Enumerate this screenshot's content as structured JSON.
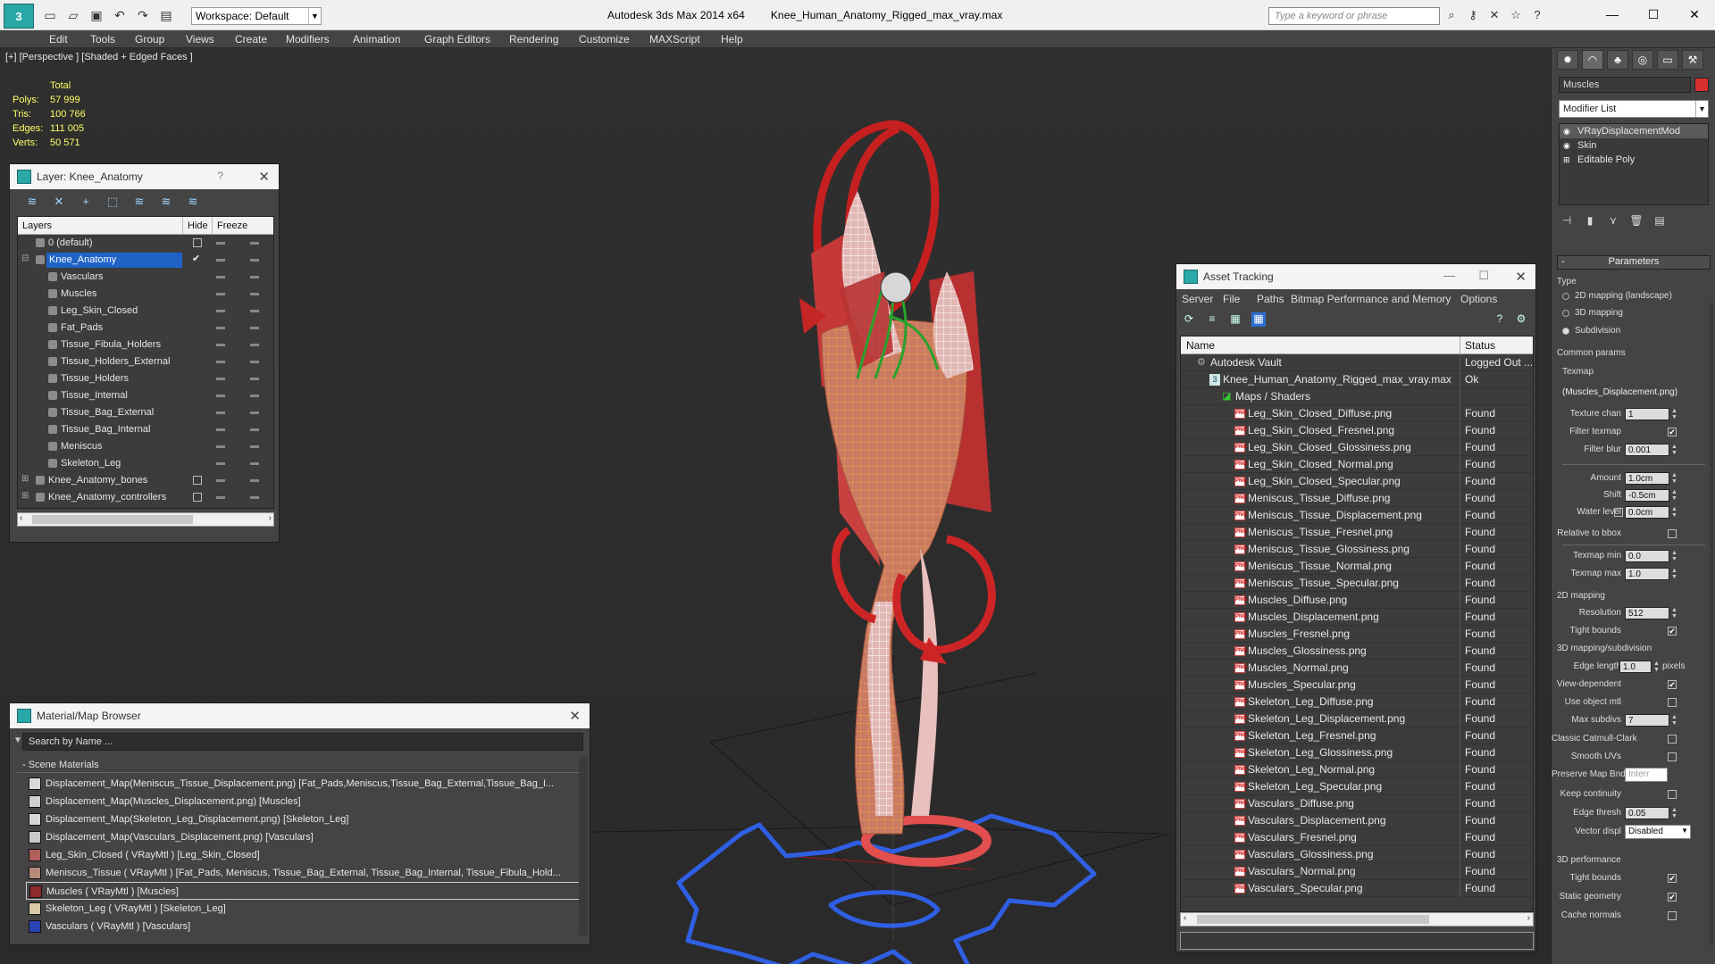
{
  "app": {
    "title": "Autodesk 3ds Max  2014 x64",
    "file": "Knee_Human_Anatomy_Rigged_max_vray.max",
    "workspace": "Workspace: Default",
    "search_placeholder": "Type a keyword or phrase"
  },
  "menu": [
    "Edit",
    "Tools",
    "Group",
    "Views",
    "Create",
    "Modifiers",
    "Animation",
    "Graph Editors",
    "Rendering",
    "Customize",
    "MAXScript",
    "Help"
  ],
  "viewport": {
    "label": "[+] [Perspective ] [Shaded + Edged Faces ]",
    "stats": {
      "header": "Total",
      "rows": [
        {
          "k": "Polys:",
          "v": "57 999"
        },
        {
          "k": "Tris:",
          "v": "100 766"
        },
        {
          "k": "Edges:",
          "v": "111 005"
        },
        {
          "k": "Verts:",
          "v": "50 571"
        }
      ]
    }
  },
  "layer_window": {
    "title": "Layer: Knee_Anatomy",
    "help": "?",
    "col_layers": "Layers",
    "col_hide": "Hide",
    "col_freeze": "Freeze",
    "rows": [
      {
        "name": "0 (default)",
        "indent": 0,
        "checkbox": true
      },
      {
        "name": "Knee_Anatomy",
        "indent": 0,
        "selected": true,
        "check": "✔"
      },
      {
        "name": "Vasculars",
        "indent": 1
      },
      {
        "name": "Muscles",
        "indent": 1
      },
      {
        "name": "Leg_Skin_Closed",
        "indent": 1
      },
      {
        "name": "Fat_Pads",
        "indent": 1
      },
      {
        "name": "Tissue_Fibula_Holders",
        "indent": 1
      },
      {
        "name": "Tissue_Holders_External",
        "indent": 1
      },
      {
        "name": "Tissue_Holders",
        "indent": 1
      },
      {
        "name": "Tissue_Internal",
        "indent": 1
      },
      {
        "name": "Tissue_Bag_External",
        "indent": 1
      },
      {
        "name": "Tissue_Bag_Internal",
        "indent": 1
      },
      {
        "name": "Meniscus",
        "indent": 1
      },
      {
        "name": "Skeleton_Leg",
        "indent": 1
      },
      {
        "name": "Knee_Anatomy_bones",
        "indent": 0,
        "expand": true,
        "checkbox": true
      },
      {
        "name": "Knee_Anatomy_controllers",
        "indent": 0,
        "expand": true,
        "checkbox": true
      }
    ]
  },
  "material_browser": {
    "title": "Material/Map Browser",
    "search_placeholder": "Search by Name ...",
    "category": "- Scene Materials",
    "rows": [
      {
        "text": "Displacement_Map(Meniscus_Tissue_Displacement.png) [Fat_Pads,Meniscus,Tissue_Bag_External,Tissue_Bag_I...",
        "swatch": "#d8d8d8"
      },
      {
        "text": "Displacement_Map(Muscles_Displacement.png) [Muscles]",
        "swatch": "#cfcfcf"
      },
      {
        "text": "Displacement_Map(Skeleton_Leg_Displacement.png) [Skeleton_Leg]",
        "swatch": "#d6d6d6"
      },
      {
        "text": "Displacement_Map(Vasculars_Displacement.png) [Vasculars]",
        "swatch": "#c8c8c8"
      },
      {
        "text": "Leg_Skin_Closed  ( VRayMtl ) [Leg_Skin_Closed]",
        "swatch": "#b0605c"
      },
      {
        "text": "Meniscus_Tissue  ( VRayMtl ) [Fat_Pads, Meniscus, Tissue_Bag_External, Tissue_Bag_Internal, Tissue_Fibula_Hold...",
        "swatch": "#b58a7a"
      },
      {
        "text": "Muscles  ( VRayMtl ) [Muscles]",
        "swatch": "#8e2b2b",
        "selected": true
      },
      {
        "text": "Skeleton_Leg  ( VRayMtl ) [Skeleton_Leg]",
        "swatch": "#d9c9a6"
      },
      {
        "text": "Vasculars  ( VRayMtl ) [Vasculars]",
        "swatch": "#2a44b8"
      }
    ]
  },
  "asset_tracking": {
    "title": "Asset Tracking",
    "menu": [
      "Server",
      "File",
      "Paths",
      "Bitmap Performance and Memory",
      "Options"
    ],
    "col_name": "Name",
    "col_status": "Status",
    "rows": [
      {
        "name": "Autodesk Vault",
        "status": "Logged Out ...",
        "indent": 0,
        "icon": "vault"
      },
      {
        "name": "Knee_Human_Anatomy_Rigged_max_vray.max",
        "status": "Ok",
        "indent": 1,
        "icon": "max"
      },
      {
        "name": "Maps / Shaders",
        "status": "",
        "indent": 2,
        "icon": "maps"
      },
      {
        "name": "Leg_Skin_Closed_Diffuse.png",
        "status": "Found",
        "indent": 3
      },
      {
        "name": "Leg_Skin_Closed_Fresnel.png",
        "status": "Found",
        "indent": 3
      },
      {
        "name": "Leg_Skin_Closed_Glossiness.png",
        "status": "Found",
        "indent": 3
      },
      {
        "name": "Leg_Skin_Closed_Normal.png",
        "status": "Found",
        "indent": 3
      },
      {
        "name": "Leg_Skin_Closed_Specular.png",
        "status": "Found",
        "indent": 3
      },
      {
        "name": "Meniscus_Tissue_Diffuse.png",
        "status": "Found",
        "indent": 3
      },
      {
        "name": "Meniscus_Tissue_Displacement.png",
        "status": "Found",
        "indent": 3
      },
      {
        "name": "Meniscus_Tissue_Fresnel.png",
        "status": "Found",
        "indent": 3
      },
      {
        "name": "Meniscus_Tissue_Glossiness.png",
        "status": "Found",
        "indent": 3
      },
      {
        "name": "Meniscus_Tissue_Normal.png",
        "status": "Found",
        "indent": 3
      },
      {
        "name": "Meniscus_Tissue_Specular.png",
        "status": "Found",
        "indent": 3
      },
      {
        "name": "Muscles_Diffuse.png",
        "status": "Found",
        "indent": 3
      },
      {
        "name": "Muscles_Displacement.png",
        "status": "Found",
        "indent": 3
      },
      {
        "name": "Muscles_Fresnel.png",
        "status": "Found",
        "indent": 3
      },
      {
        "name": "Muscles_Glossiness.png",
        "status": "Found",
        "indent": 3
      },
      {
        "name": "Muscles_Normal.png",
        "status": "Found",
        "indent": 3
      },
      {
        "name": "Muscles_Specular.png",
        "status": "Found",
        "indent": 3
      },
      {
        "name": "Skeleton_Leg_Diffuse.png",
        "status": "Found",
        "indent": 3
      },
      {
        "name": "Skeleton_Leg_Displacement.png",
        "status": "Found",
        "indent": 3
      },
      {
        "name": "Skeleton_Leg_Fresnel.png",
        "status": "Found",
        "indent": 3
      },
      {
        "name": "Skeleton_Leg_Glossiness.png",
        "status": "Found",
        "indent": 3
      },
      {
        "name": "Skeleton_Leg_Normal.png",
        "status": "Found",
        "indent": 3
      },
      {
        "name": "Skeleton_Leg_Specular.png",
        "status": "Found",
        "indent": 3
      },
      {
        "name": "Vasculars_Diffuse.png",
        "status": "Found",
        "indent": 3
      },
      {
        "name": "Vasculars_Displacement.png",
        "status": "Found",
        "indent": 3
      },
      {
        "name": "Vasculars_Fresnel.png",
        "status": "Found",
        "indent": 3
      },
      {
        "name": "Vasculars_Glossiness.png",
        "status": "Found",
        "indent": 3
      },
      {
        "name": "Vasculars_Normal.png",
        "status": "Found",
        "indent": 3
      },
      {
        "name": "Vasculars_Specular.png",
        "status": "Found",
        "indent": 3
      }
    ]
  },
  "command_panel": {
    "object_name": "Muscles",
    "object_color": "#d73030",
    "modifier_list": "Modifier List",
    "stack": [
      {
        "name": "VRayDisplacementMod",
        "selected": true
      },
      {
        "name": "Skin"
      },
      {
        "name": "Editable Poly"
      }
    ],
    "params": {
      "title": "Parameters",
      "type_label": "Type",
      "type_options": [
        "2D mapping (landscape)",
        "3D mapping",
        "Subdivision"
      ],
      "type_selected": 2,
      "common": "Common params",
      "texmap_label": "Texmap",
      "texmap_value": "(Muscles_Displacement.png)",
      "texture_chan_label": "Texture chan",
      "texture_chan": "1",
      "filter_texmap_label": "Filter texmap",
      "filter_blur_label": "Filter blur",
      "filter_blur": "0.001",
      "amount_label": "Amount",
      "amount": "1.0cm",
      "shift_label": "Shift",
      "shift": "-0.5cm",
      "water_label": "Water level",
      "water": "0.0cm",
      "relative_label": "Relative to bbox",
      "texmap_min_label": "Texmap min",
      "texmap_min": "0.0",
      "texmap_max_label": "Texmap max",
      "texmap_max": "1.0",
      "mapping2d": "2D mapping",
      "resolution_label": "Resolution",
      "resolution": "512",
      "tight_bounds_label": "Tight bounds",
      "mapping3d": "3D mapping/subdivision",
      "edge_length_label": "Edge length",
      "edge_length": "1.0",
      "pixels": "pixels",
      "view_dep_label": "View-dependent",
      "use_obj_label": "Use object mtl",
      "max_subdivs_label": "Max subdivs",
      "max_subdivs": "7",
      "catmull_label": "Classic Catmull-Clark",
      "smooth_uv_label": "Smooth UVs",
      "preserve_label": "Preserve Map Bnd",
      "preserve_value": "Interr",
      "keep_cont_label": "Keep continuity",
      "edge_thresh_label": "Edge thresh",
      "edge_thresh": "0.05",
      "vector_label": "Vector displ",
      "vector_value": "Disabled",
      "perf": "3D performance",
      "perf_tight_label": "Tight bounds",
      "static_label": "Static geometry",
      "cache_label": "Cache normals"
    }
  }
}
